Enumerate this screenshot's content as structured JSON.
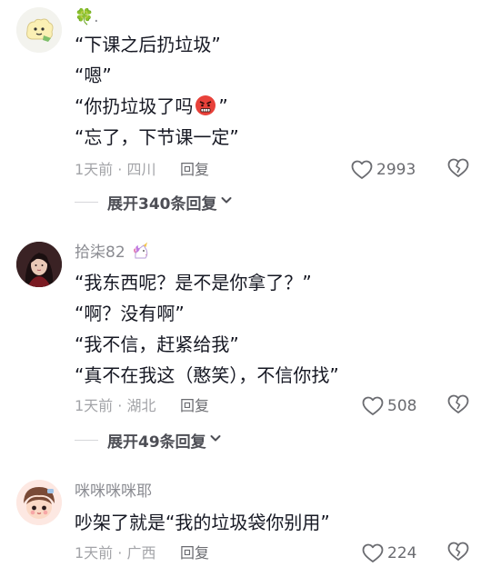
{
  "comments": [
    {
      "username": "🍀.",
      "lines": [
        "“下课之后扔垃圾”",
        "“嗯”",
        "“你扔垃圾了吗",
        "”",
        "“忘了，下节课一定”"
      ],
      "time": "1天前 · 四川",
      "reply_label": "回复",
      "likes": "2993",
      "expand_label": "展开340条回复"
    },
    {
      "username": "拾柒82",
      "lines": [
        "“我东西呢？是不是你拿了？”",
        "“啊？没有啊”",
        "“我不信，赶紧给我”",
        "“真不在我这（憨笑），不信你找”"
      ],
      "time": "1天前 · 湖北",
      "reply_label": "回复",
      "likes": "508",
      "expand_label": "展开49条回复"
    },
    {
      "username": "咪咪咪咪耶",
      "lines": [
        "吵架了就是“我的垃圾袋你别用”"
      ],
      "time": "1天前 · 广西",
      "reply_label": "回复",
      "likes": "224"
    }
  ],
  "colors": {
    "text": "#161823",
    "muted": "#a3a4a8",
    "secondary": "#6a6b70",
    "angry_emoji": "#e8413a"
  },
  "icons": {
    "like": "heart-outline-icon",
    "dislike": "broken-heart-icon",
    "expand": "chevron-down-icon",
    "emoji": "angry-face-emoji",
    "unicorn": "unicorn-emoji"
  }
}
